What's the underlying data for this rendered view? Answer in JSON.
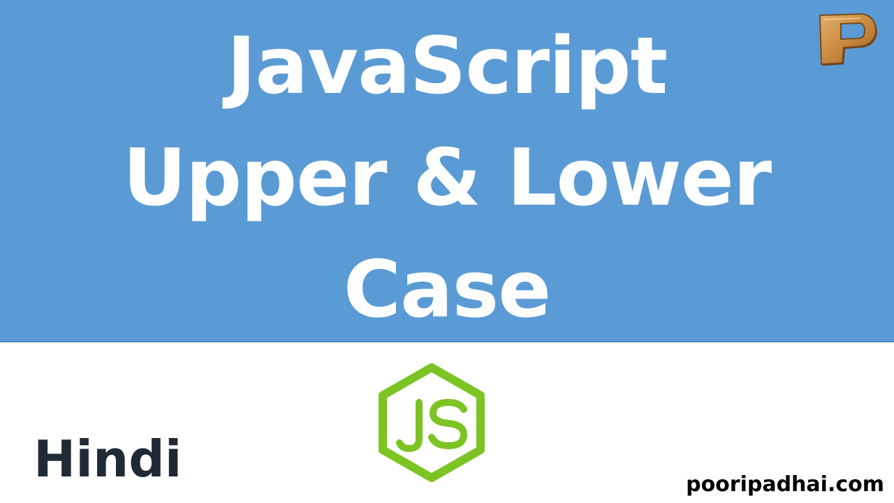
{
  "banner": {
    "title_lines": [
      "JavaScript",
      "Upper & Lower",
      "Case"
    ],
    "background_color": "#5b9bd5",
    "text_color": "#ffffff"
  },
  "brand_logo": {
    "icon": "wooden-letter-p-logo-icon",
    "letter": "P"
  },
  "js_logo": {
    "icon": "nodejs-hexagon-js-logo-icon",
    "text": "JS",
    "color": "#7cc324"
  },
  "language_label": "Hindi",
  "website": "pooripadhai.com"
}
